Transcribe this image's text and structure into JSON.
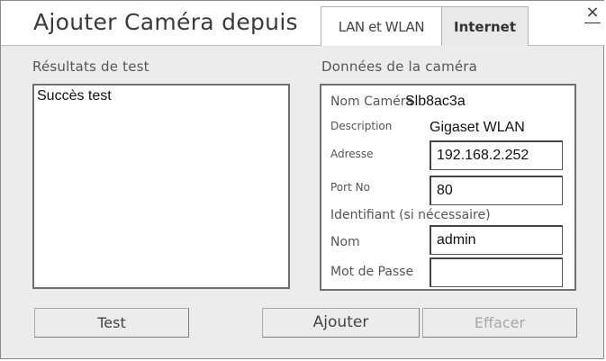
{
  "window": {
    "title": "Ajouter Caméra depuis",
    "close_label": "×"
  },
  "tabs": [
    {
      "label": "LAN et WLAN",
      "active": true
    },
    {
      "label": "Internet",
      "active": false
    }
  ],
  "results": {
    "label": "Résultats de test",
    "text": "Succès test"
  },
  "camera": {
    "label": "Données de la caméra",
    "name_label": "Nom Caméra",
    "name_value": "Slb8ac3a",
    "description_label": "Description",
    "description_value": "Gigaset WLAN",
    "address_label": "Adresse",
    "address_value": "192.168.2.252",
    "port_label": "Port No",
    "port_value": "80",
    "login_label": "Identifiant (si nécessaire)",
    "user_label": "Nom",
    "user_value": "admin",
    "password_label": "Mot de Passe",
    "password_value": ""
  },
  "buttons": {
    "test": "Test",
    "add": "Ajouter",
    "clear": "Effacer",
    "clear_enabled": false
  }
}
